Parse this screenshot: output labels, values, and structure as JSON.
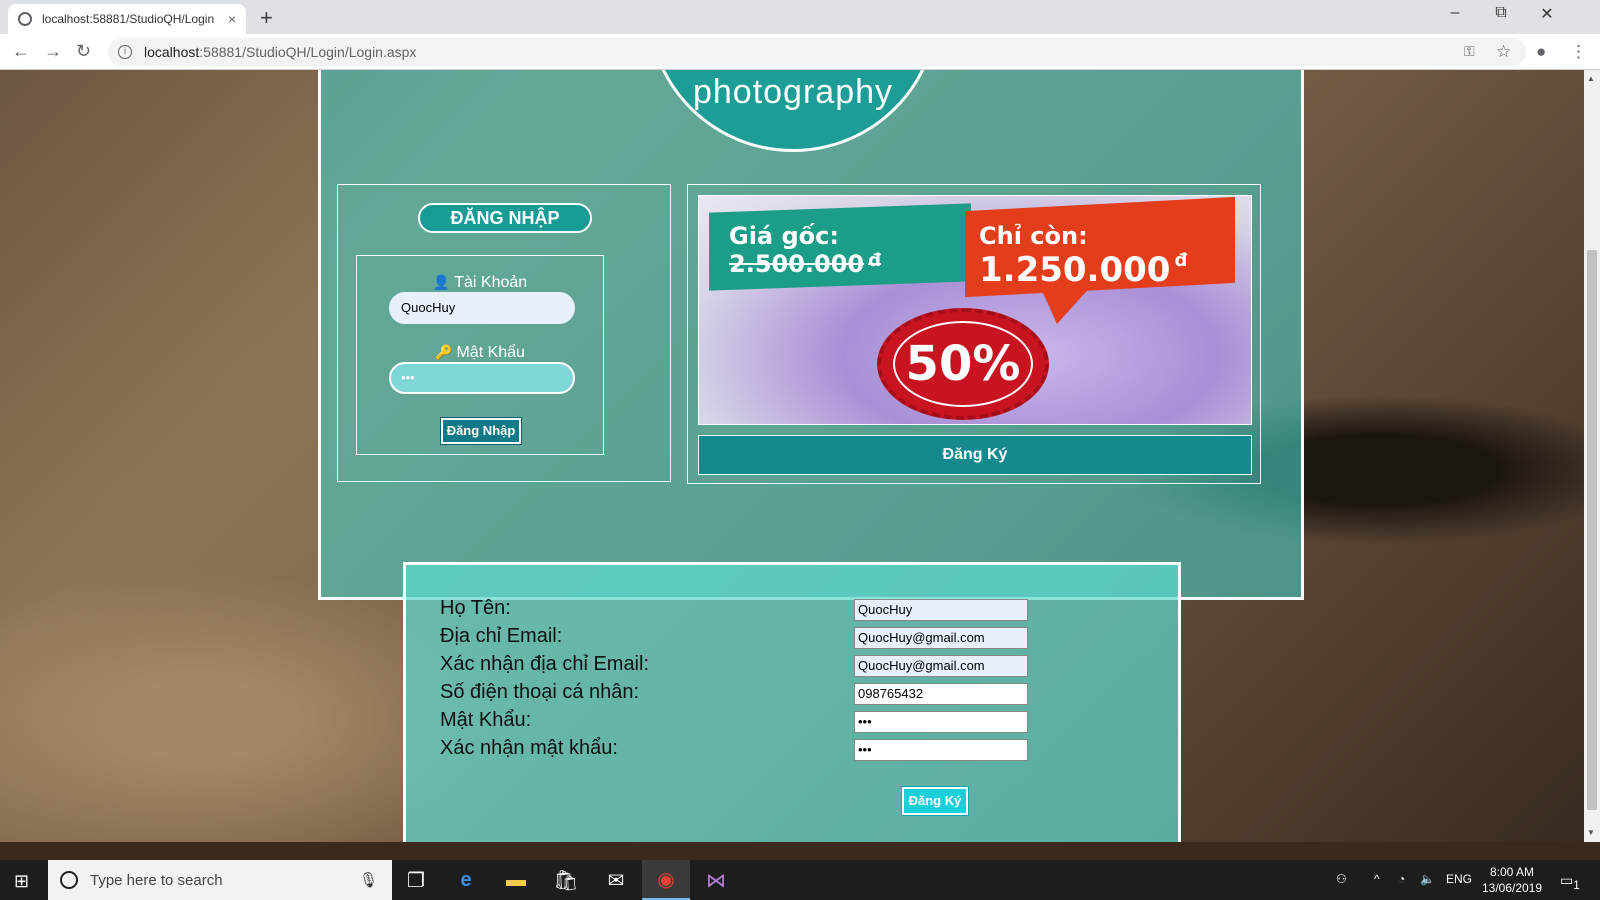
{
  "browser": {
    "tab_title": "localhost:58881/StudioQH/Login",
    "tab_close": "×",
    "new_tab": "+",
    "url_host": "localhost",
    "url_path": ":58881/StudioQH/Login/Login.aspx",
    "back_icon": "arrow-left-icon",
    "forward_icon": "arrow-right-icon",
    "reload_icon": "reload-icon",
    "minimize": "–",
    "maximize": "⧉",
    "close": "✕"
  },
  "logo": {
    "text": "photography"
  },
  "login": {
    "title": "ĐĂNG NHẬP",
    "username_label": "Tài Khoản",
    "username_value": "QuocHuy",
    "password_label": "Mật Khẩu",
    "password_value": "•••",
    "button_label": "Đăng Nhập"
  },
  "promo": {
    "original_label": "Giá gốc:",
    "original_price": "2.500.000",
    "current_label": "Chỉ còn:",
    "current_price": "1.250.000",
    "currency": "đ",
    "discount": "50%",
    "register_button": "Đăng Ký"
  },
  "register": {
    "rows": [
      {
        "label": "Họ Tên:",
        "value": "QuocHuy"
      },
      {
        "label": "Địa chỉ Email:",
        "value": "QuocHuy@gmail.com"
      },
      {
        "label": "Xác nhận địa chỉ Email:",
        "value": "QuocHuy@gmail.com"
      },
      {
        "label": "Số điện thoại cá nhân:",
        "value": "098765432"
      },
      {
        "label": "Mật Khẩu:",
        "value": "•••"
      },
      {
        "label": "Xác nhận mật khẩu:",
        "value": "•••"
      }
    ],
    "button_label": "Đăng Ký"
  },
  "taskbar": {
    "search_placeholder": "Type here to search",
    "language": "ENG",
    "time": "8:00 AM",
    "date": "13/06/2019",
    "notification_count": "1"
  },
  "colors": {
    "panel": "#48c8be",
    "accent": "#179c95",
    "button": "#117a86",
    "promo_red": "#e33d1c",
    "promo_green": "#1b9d88"
  }
}
